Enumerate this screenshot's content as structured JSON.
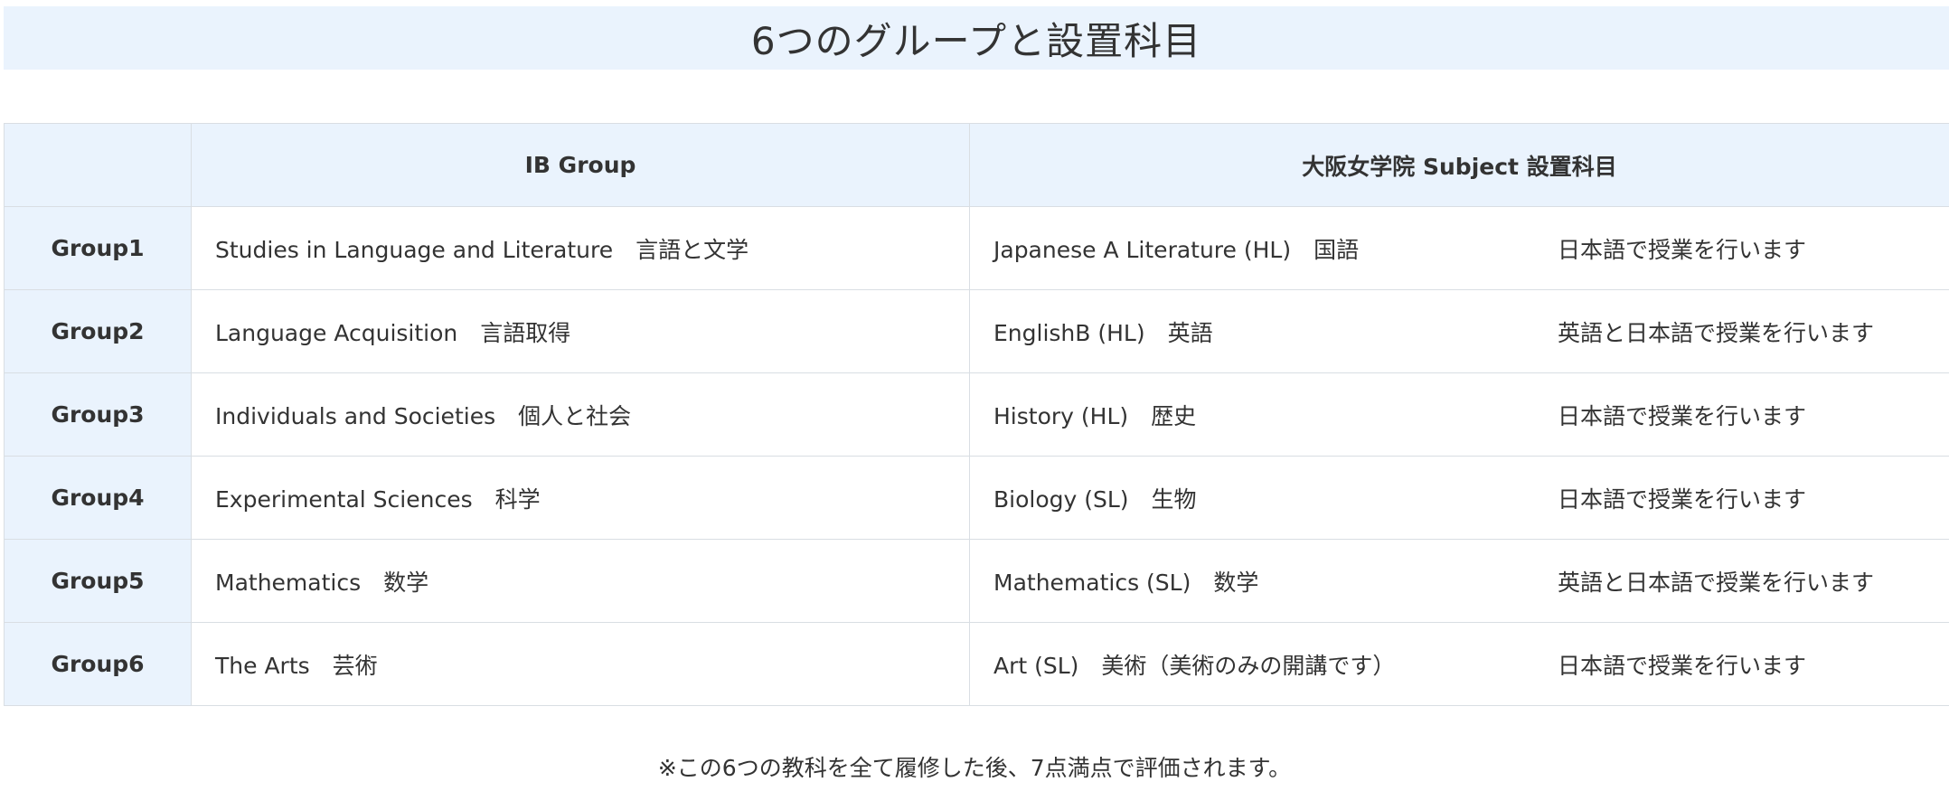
{
  "header": {
    "title": "6つのグループと設置科目"
  },
  "table": {
    "columns": {
      "group": "",
      "ib_group": "IB Group",
      "subject": "大阪女学院 Subject 設置科目"
    },
    "rows": [
      {
        "group": "Group1",
        "ib_group": "Studies in Language and Literature　言語と文学",
        "subject": "Japanese A Literature (HL)　国語",
        "note": "日本語で授業を行います"
      },
      {
        "group": "Group2",
        "ib_group": "Language Acquisition　言語取得",
        "subject": "EnglishB (HL)　英語",
        "note": "英語と日本語で授業を行います"
      },
      {
        "group": "Group3",
        "ib_group": "Individuals and Societies　個人と社会",
        "subject": "History (HL)　歴史",
        "note": "日本語で授業を行います"
      },
      {
        "group": "Group4",
        "ib_group": "Experimental Sciences　科学",
        "subject": "Biology (SL)　生物",
        "note": "日本語で授業を行います"
      },
      {
        "group": "Group5",
        "ib_group": "Mathematics　数学",
        "subject": "Mathematics (SL)　数学",
        "note": "英語と日本語で授業を行います"
      },
      {
        "group": "Group6",
        "ib_group": "The Arts　芸術",
        "subject": "Art (SL)　美術（美術のみの開講です）",
        "note": "日本語で授業を行います"
      }
    ]
  },
  "footnote": "※この6つの教科を全て履修した後、7点満点で評価されます。"
}
